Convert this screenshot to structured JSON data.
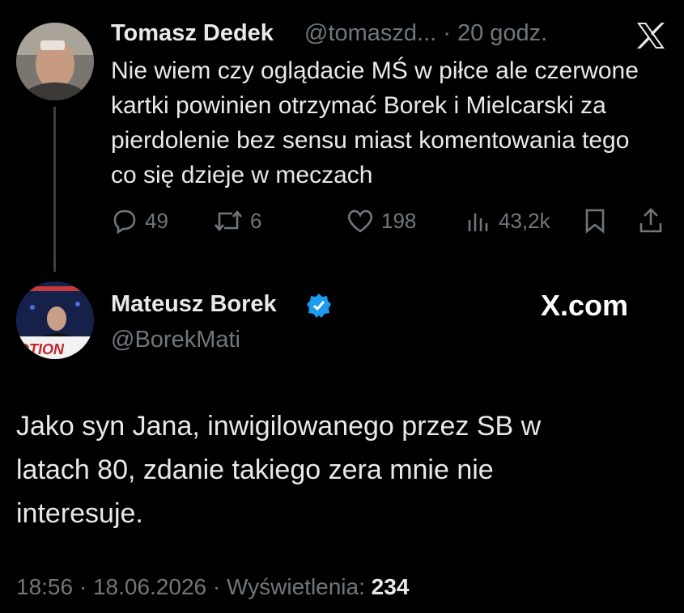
{
  "parent_tweet": {
    "author_name": "Tomasz Dedek",
    "handle_and_time": "@tomaszd... · 20 godz.",
    "text": "Nie wiem czy oglądacie MŚ w piłce ale czerwone kartki powinien otrzymać Borek i Mielcarski za pierdolenie bez sensu miast komentowania tego co się dzieje w meczach",
    "stats": {
      "replies": "49",
      "retweets": "6",
      "likes": "198",
      "views": "43,2k"
    },
    "close_icon": "x-logo-icon"
  },
  "reply_tweet": {
    "author_name": "Mateusz Borek",
    "verified": true,
    "handle": "@BorekMati",
    "brand": "X.com",
    "text": "Jako syn Jana, inwigilowanego przez SB w latach 80, zdanie takiego zera mnie nie interesuje.",
    "timestamp": "18:56 · 18.06.2026 · Wyświetlenia: ",
    "views_count": "234"
  },
  "colors": {
    "background": "#000000",
    "text": "#e7e9ea",
    "muted": "#71767b",
    "verified": "#1d9bf0"
  }
}
